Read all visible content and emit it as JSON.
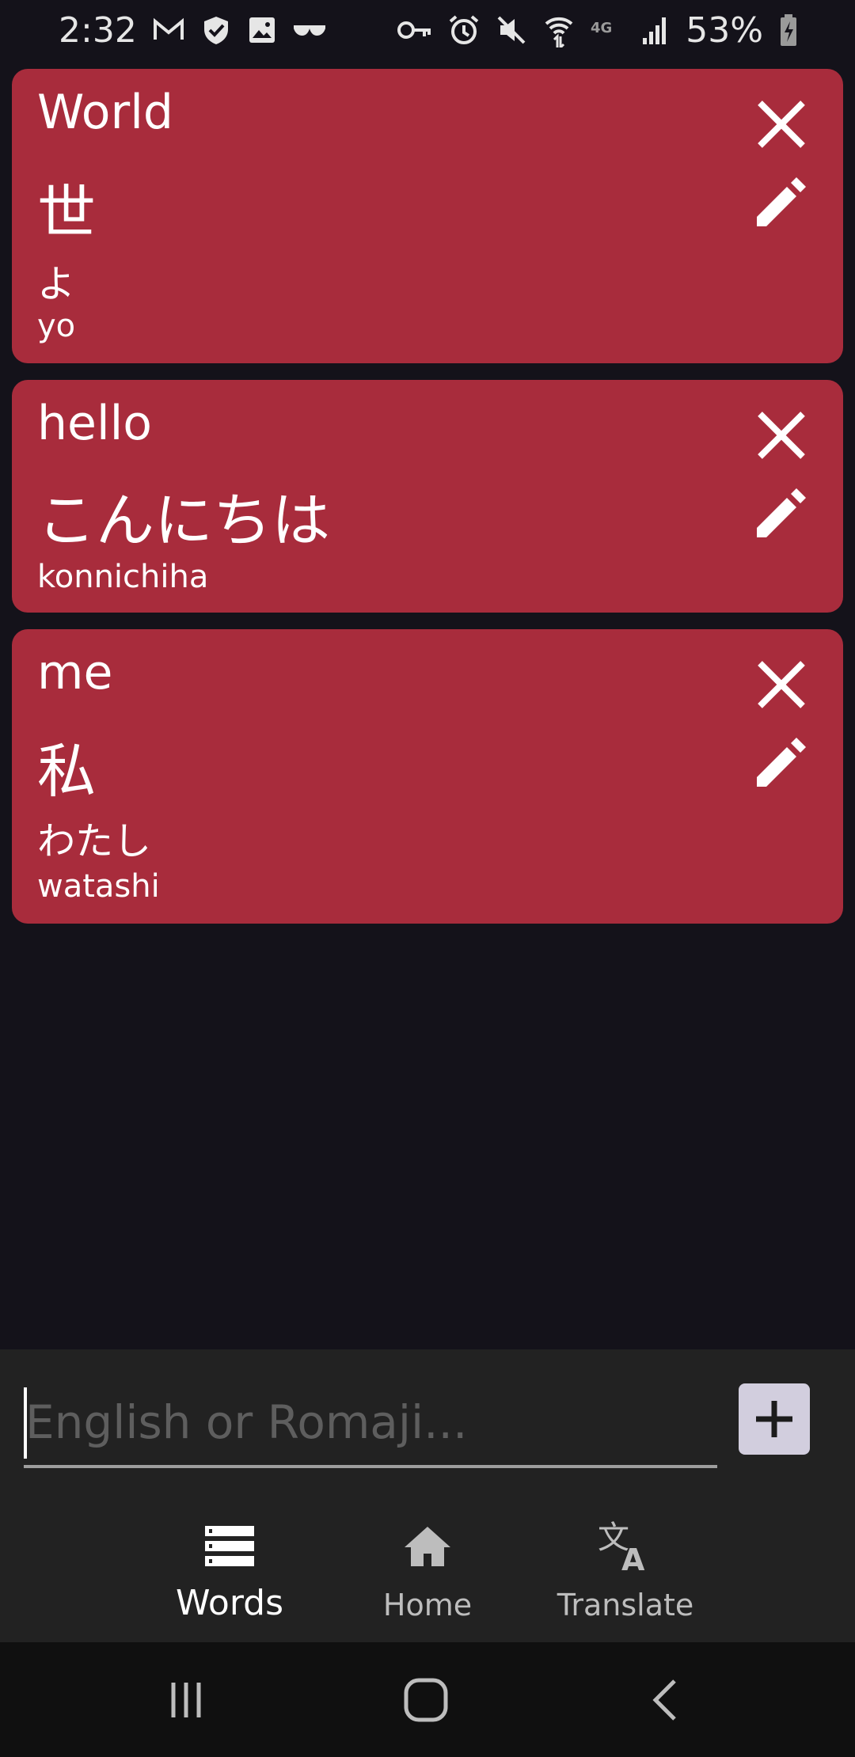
{
  "status_bar": {
    "time": "2:32",
    "battery": "53%",
    "left_icons": [
      "gmail-icon",
      "checkmark-shield-icon",
      "image-icon",
      "incognito-glasses-icon"
    ],
    "right_icons": [
      "key-icon",
      "alarm-icon",
      "mute-icon",
      "wifi-icon",
      "4g-icon",
      "signal-icon",
      "battery-charging-icon"
    ]
  },
  "cards": [
    {
      "english": "World",
      "kanji": "世",
      "kana": "よ",
      "romaji": "yo"
    },
    {
      "english": "hello",
      "kanji": "こんにちは",
      "kana": "",
      "romaji": "konnichiha"
    },
    {
      "english": "me",
      "kanji": "私",
      "kana": "わたし",
      "romaji": "watashi"
    }
  ],
  "input": {
    "value": "",
    "placeholder": "English or Romaji..."
  },
  "bottom_nav": {
    "items": [
      {
        "label": "Words",
        "icon": "list-icon",
        "active": true
      },
      {
        "label": "Home",
        "icon": "home-icon",
        "active": false
      },
      {
        "label": "Translate",
        "icon": "translate-icon",
        "active": false
      }
    ]
  },
  "colors": {
    "card": "#a82c3c",
    "background": "#14121a",
    "panel": "#222222",
    "add_button": "#d2cede"
  }
}
